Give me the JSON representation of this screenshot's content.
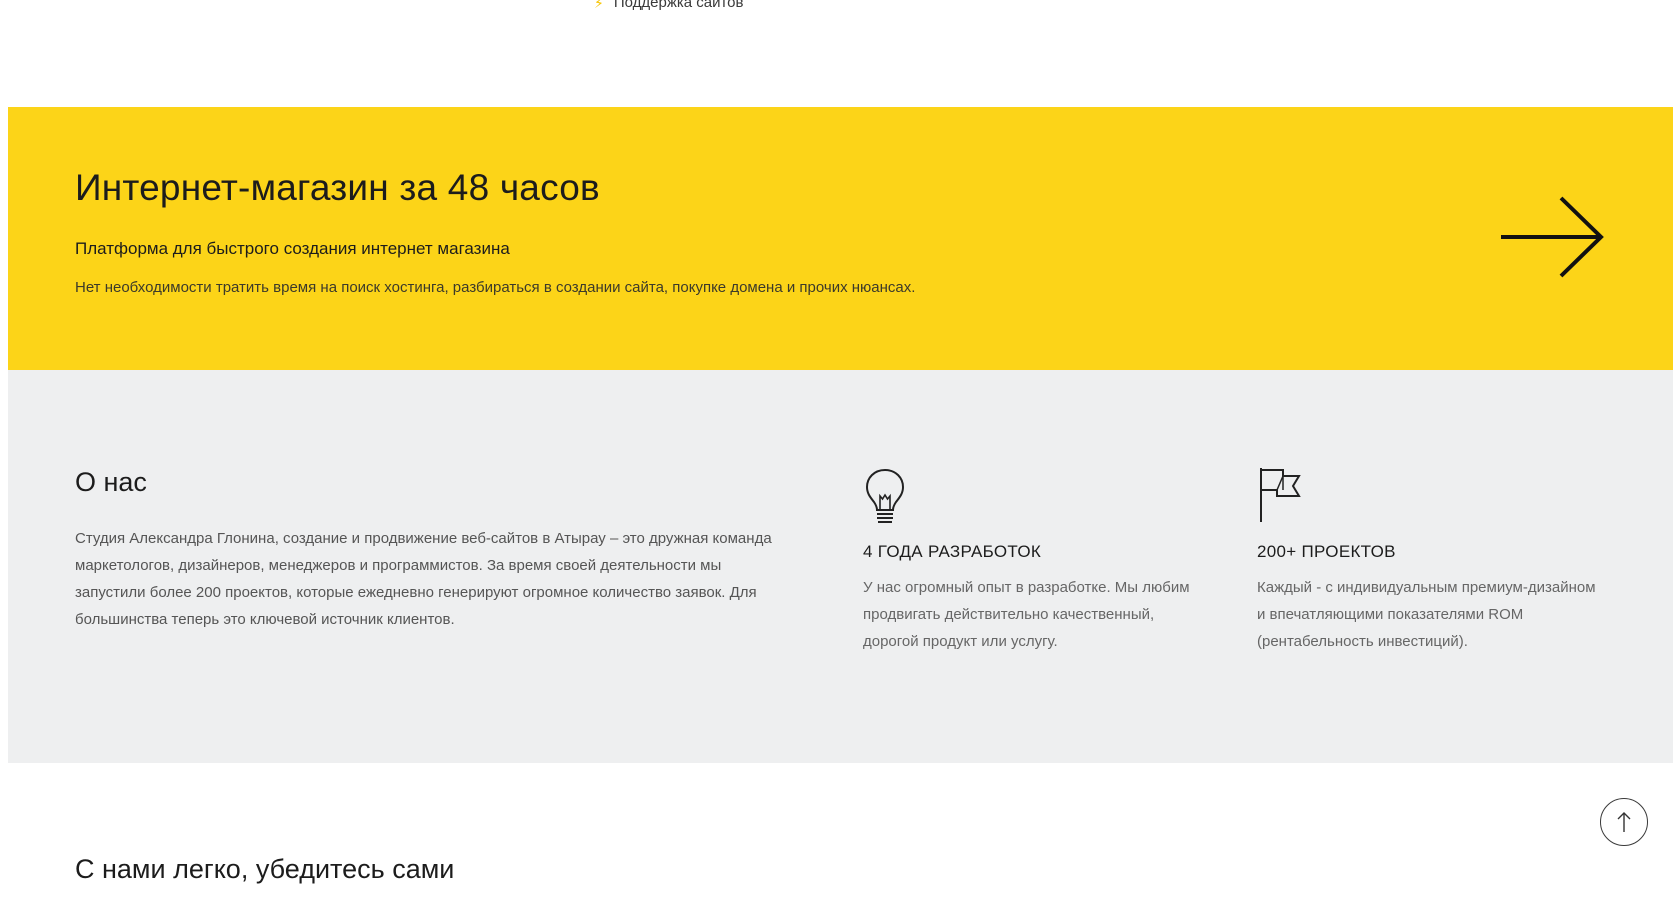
{
  "top": {
    "link_label": "Поддержка сайтов",
    "link_icon": "lightning-icon"
  },
  "promo": {
    "title": "Интернет-магазин за 48 часов",
    "subtitle": "Платформа для быстрого создания интернет магазина",
    "description": "Нет необходимости тратить время на поиск хостинга, разбираться в создании сайта, покупке домена и прочих нюансах.",
    "arrow_icon": "arrow-right-icon",
    "background_color": "#fcd418"
  },
  "about": {
    "title": "О нас",
    "text": "Студия Александра Глонина, создание и продвижение веб-сайтов в Атырау – это дружная команда маркетологов, дизайнеров, менеджеров и программистов. За время своей деятельности мы запустили более 200 проектов, которые ежедневно генерируют огромное количество заявок. Для большинства теперь это ключевой источник клиентов.",
    "background_color": "#eeeff0",
    "features": [
      {
        "icon": "lightbulb-icon",
        "title": "4 ГОДА РАЗРАБОТОК",
        "text": "У нас огромный опыт в разработке. Мы любим продвигать действительно качественный, дорогой продукт или услугу."
      },
      {
        "icon": "flag-icon",
        "title": "200+ ПРОЕКТОВ",
        "text": "Каждый - с индивидуальным премиум-дизайном и впечатляющими показателями ROM (рентабельность инвестиций)."
      }
    ]
  },
  "section_next": {
    "title": "С нами легко, убедитесь сами"
  },
  "scroll_top": {
    "icon": "arrow-up-icon"
  }
}
